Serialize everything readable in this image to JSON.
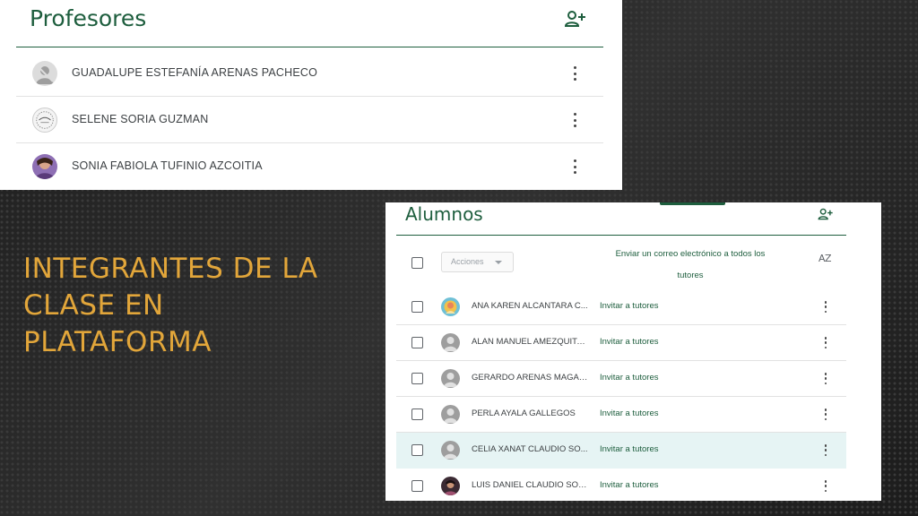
{
  "slide": {
    "heading_lines": [
      "INTEGRANTES DE LA",
      "CLASE EN",
      "PLATAFORMA"
    ],
    "heading_color": "#e2a63a"
  },
  "profesores": {
    "title": "Profesores",
    "add_icon": "person-add-icon",
    "teachers": [
      {
        "name": "GUADALUPE ESTEFANÍA ARENAS PACHECO",
        "avatar": "default-avatar"
      },
      {
        "name": "SELENE SORIA GUZMAN",
        "avatar": "photo-avatar"
      },
      {
        "name": "SONIA FABIOLA TUFINIO AZCOITIA",
        "avatar": "photo-avatar"
      }
    ]
  },
  "alumnos": {
    "title": "Alumnos",
    "add_icon": "person-add-icon",
    "actions_label": "Acciones",
    "email_link_line1": "Enviar un correo electrónico a todos los",
    "email_link_line2": "tutores",
    "sort_label": "AZ",
    "invite_label": "Invitar a tutores",
    "students": [
      {
        "name": "ANA KAREN ALCANTARA C...",
        "avatar": "photo-avatar"
      },
      {
        "name": "ALAN MANUEL AMEZQUITA ...",
        "avatar": "default-avatar"
      },
      {
        "name": "GERARDO ARENAS MAGAÑA",
        "avatar": "default-avatar"
      },
      {
        "name": "PERLA AYALA GALLEGOS",
        "avatar": "default-avatar"
      },
      {
        "name": "CELIA XANAT CLAUDIO SO...",
        "avatar": "default-avatar",
        "highlighted": true
      },
      {
        "name": "LUIS DANIEL CLAUDIO SOSA",
        "avatar": "photo-avatar"
      }
    ]
  },
  "colors": {
    "brand_green": "#1e5e3e",
    "row_highlight": "#e6f4f4"
  }
}
